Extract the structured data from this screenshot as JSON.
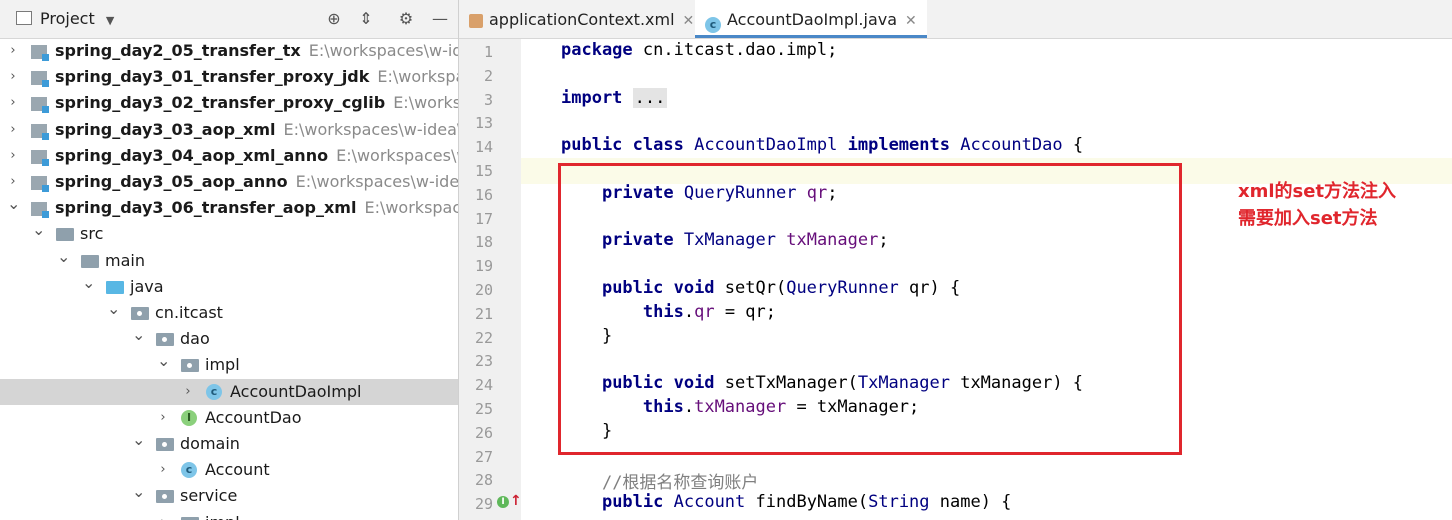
{
  "project_panel": {
    "title": "Project",
    "icons": [
      "target-icon",
      "collapse-icon",
      "gear-icon",
      "minimize-icon"
    ],
    "tree": [
      {
        "label": "spring_day2_05_transfer_tx",
        "path": "E:\\workspaces\\w-idea\\",
        "level": 0,
        "type": "module",
        "expanded": false
      },
      {
        "label": "spring_day3_01_transfer_proxy_jdk",
        "path": "E:\\workspaces\\",
        "level": 0,
        "type": "module",
        "expanded": false
      },
      {
        "label": "spring_day3_02_transfer_proxy_cglib",
        "path": "E:\\workspace",
        "level": 0,
        "type": "module",
        "expanded": false
      },
      {
        "label": "spring_day3_03_aop_xml",
        "path": "E:\\workspaces\\w-idea\\hei",
        "level": 0,
        "type": "module",
        "expanded": false
      },
      {
        "label": "spring_day3_04_aop_xml_anno",
        "path": "E:\\workspaces\\w-id",
        "level": 0,
        "type": "module",
        "expanded": false
      },
      {
        "label": "spring_day3_05_aop_anno",
        "path": "E:\\workspaces\\w-idea\\he",
        "level": 0,
        "type": "module",
        "expanded": false
      },
      {
        "label": "spring_day3_06_transfer_aop_xml",
        "path": "E:\\workspaces\\w",
        "level": 0,
        "type": "module",
        "expanded": true
      },
      {
        "label": "src",
        "path": "",
        "level": 1,
        "type": "folder",
        "expanded": true
      },
      {
        "label": "main",
        "path": "",
        "level": 2,
        "type": "folder",
        "expanded": true
      },
      {
        "label": "java",
        "path": "",
        "level": 3,
        "type": "source",
        "expanded": true
      },
      {
        "label": "cn.itcast",
        "path": "",
        "level": 4,
        "type": "package",
        "expanded": true
      },
      {
        "label": "dao",
        "path": "",
        "level": 5,
        "type": "package",
        "expanded": true
      },
      {
        "label": "impl",
        "path": "",
        "level": 6,
        "type": "package",
        "expanded": true
      },
      {
        "label": "AccountDaoImpl",
        "path": "",
        "level": 7,
        "type": "class",
        "expanded": false,
        "selected": true
      },
      {
        "label": "AccountDao",
        "path": "",
        "level": 6,
        "type": "interface",
        "expanded": false
      },
      {
        "label": "domain",
        "path": "",
        "level": 5,
        "type": "package",
        "expanded": true
      },
      {
        "label": "Account",
        "path": "",
        "level": 6,
        "type": "class",
        "expanded": false
      },
      {
        "label": "service",
        "path": "",
        "level": 5,
        "type": "package",
        "expanded": true
      },
      {
        "label": "impl",
        "path": "",
        "level": 6,
        "type": "package",
        "expanded": false
      }
    ]
  },
  "tabs": [
    {
      "label": "applicationContext.xml",
      "icon": "xml-file-icon",
      "active": false
    },
    {
      "label": "AccountDaoImpl.java",
      "icon": "class-file-icon",
      "active": true
    }
  ],
  "code_lines": [
    {
      "n": "1",
      "html": "<span class=\"kw\">package</span> cn.itcast.dao.impl;"
    },
    {
      "n": "2",
      "html": ""
    },
    {
      "n": "3",
      "html": "<span class=\"kw\">import</span> <span class=\"fold-box\">...</span>"
    },
    {
      "n": "13",
      "html": ""
    },
    {
      "n": "14",
      "html": "<span class=\"kw\">public class</span> <span class=\"ty\">AccountDaoImpl</span> <span class=\"kw\">implements</span> <span class=\"ty\">AccountDao</span> {"
    },
    {
      "n": "15",
      "html": ""
    },
    {
      "n": "16",
      "html": "    <span class=\"kw\">private</span> <span class=\"ty\">QueryRunner</span> <span class=\"fld\">qr</span>;"
    },
    {
      "n": "17",
      "html": ""
    },
    {
      "n": "18",
      "html": "    <span class=\"kw\">private</span> <span class=\"ty\">TxManager</span> <span class=\"fld\">txManager</span>;"
    },
    {
      "n": "19",
      "html": ""
    },
    {
      "n": "20",
      "html": "    <span class=\"kw\">public void</span> setQr(<span class=\"ty\">QueryRunner</span> qr) {"
    },
    {
      "n": "21",
      "html": "        <span class=\"kw\">this</span>.<span class=\"fld\">qr</span> = qr;"
    },
    {
      "n": "22",
      "html": "    }"
    },
    {
      "n": "23",
      "html": ""
    },
    {
      "n": "24",
      "html": "    <span class=\"kw\">public void</span> setTxManager(<span class=\"ty\">TxManager</span> txManager) {"
    },
    {
      "n": "25",
      "html": "        <span class=\"kw\">this</span>.<span class=\"fld\">txManager</span> = txManager;"
    },
    {
      "n": "26",
      "html": "    }"
    },
    {
      "n": "27",
      "html": ""
    },
    {
      "n": "28",
      "html": "    <span class=\"cm\">//根据名称查询账户</span>"
    },
    {
      "n": "29",
      "html": "    <span class=\"kw\">public</span> <span class=\"ty\">Account</span> findByName(<span class=\"ty\">String</span> name) {"
    }
  ],
  "annotation": {
    "line1": "xml的set方法注入",
    "line2": "需要加入set方法",
    "color": "#e0262d"
  }
}
